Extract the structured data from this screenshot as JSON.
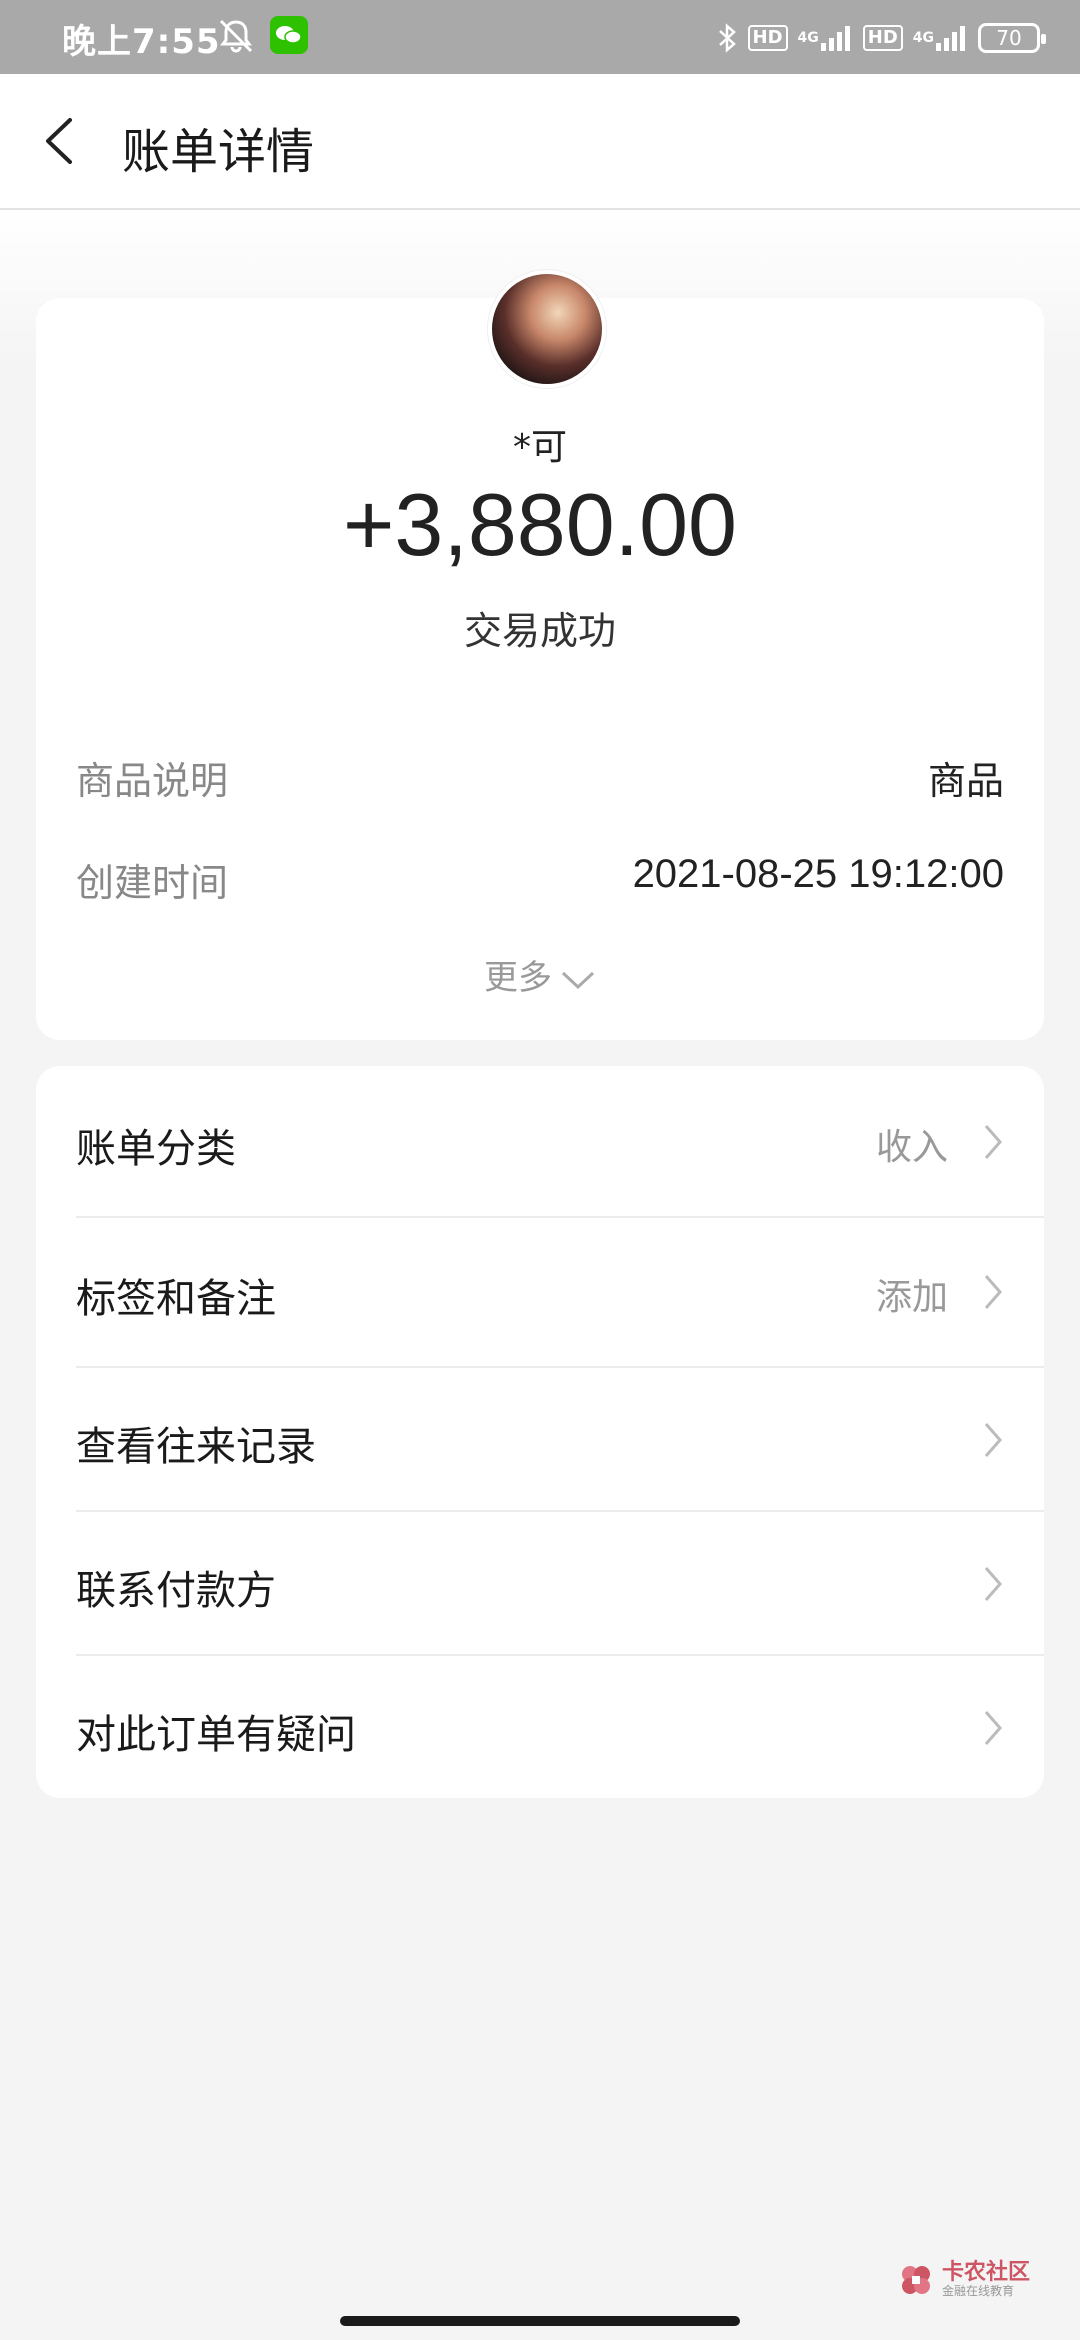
{
  "status_bar": {
    "time": "晚上7:55",
    "hd_label": "HD",
    "network_label": "4G",
    "battery": "70"
  },
  "navbar": {
    "title": "账单详情"
  },
  "transaction": {
    "payer_name": "*可",
    "amount": "+3,880.00",
    "status": "交易成功"
  },
  "details": [
    {
      "label": "商品说明",
      "value": "商品"
    },
    {
      "label": "创建时间",
      "value": "2021-08-25 19:12:00"
    }
  ],
  "more_label": "更多",
  "menu": [
    {
      "label": "账单分类",
      "value": "收入"
    },
    {
      "label": "标签和备注",
      "value": "添加"
    },
    {
      "label": "查看往来记录",
      "value": ""
    },
    {
      "label": "联系付款方",
      "value": ""
    },
    {
      "label": "对此订单有疑问",
      "value": ""
    }
  ],
  "watermark": {
    "title": "卡农社区",
    "subtitle": "金融在线教育"
  },
  "colors": {
    "status_bar": "#a9a9a9",
    "background": "#f4f4f4",
    "card": "#ffffff",
    "secondary_text": "#999999",
    "watermark": "#c83a4a"
  },
  "icons": {
    "back": "chevron-left-icon",
    "row": "chevron-right-icon",
    "more": "chevron-down-icon"
  }
}
